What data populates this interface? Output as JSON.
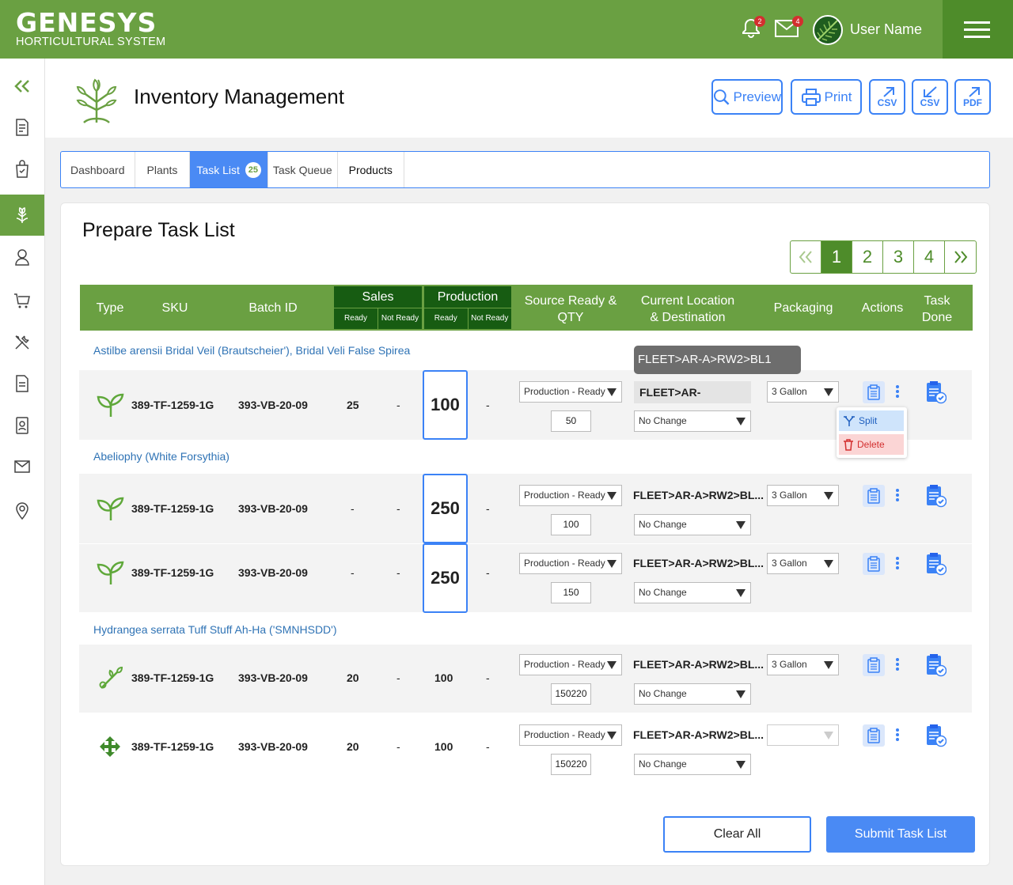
{
  "app": {
    "brand": "GENESYS",
    "brand_sub": "HORTICULTURAL SYSTEM",
    "notif_count": "2",
    "mail_count": "4",
    "user_name": "User Name"
  },
  "page": {
    "title": "Inventory Management",
    "toolbar": {
      "preview": "Preview",
      "print": "Print",
      "csv_export": "CSV",
      "csv_import": "CSV",
      "pdf": "PDF"
    }
  },
  "tabs": [
    {
      "label": "Dashboard"
    },
    {
      "label": "Plants"
    },
    {
      "label": "Task List",
      "badge": "25"
    },
    {
      "label": "Task Queue"
    },
    {
      "label": "Products"
    }
  ],
  "section_title": "Prepare Task List",
  "pagination": {
    "pages": [
      "1",
      "2",
      "3",
      "4"
    ],
    "current": "1"
  },
  "table": {
    "headers": {
      "type": "Type",
      "sku": "SKU",
      "batch": "Batch ID",
      "sales": "Sales",
      "production": "Production",
      "ready": "Ready",
      "not_ready": "Not Ready",
      "source_l1": "Source Ready &",
      "source_l2": "QTY",
      "loc_l1": "Current Location",
      "loc_l2": "& Destination",
      "packaging": "Packaging",
      "actions": "Actions",
      "done_l1": "Task",
      "done_l2": "Done"
    },
    "groups": [
      "Astilbe arensii Bridal Veil (Brautscheier'), Bridal Veli False Spirea",
      "Abeliophy (White Forsythia)",
      "Hydrangea serrata Tuff Stuff Ah-Ha ('SMNHSDD')"
    ],
    "rows": [
      {
        "type_icon": "sprout-icon",
        "sku": "389-TF-1259-1G",
        "batch": "393-VB-20-09",
        "sales_ready": "25",
        "sales_not_ready": "-",
        "prod_ready": "100",
        "prod_not_ready": "-",
        "source": "Production - Ready",
        "qty": "50",
        "location": "FLEET>AR-A>RW2>...",
        "destination": "No Change",
        "packaging": "3 Gallon"
      },
      {
        "type_icon": "sprout-icon",
        "sku": "389-TF-1259-1G",
        "batch": "393-VB-20-09",
        "sales_ready": "-",
        "sales_not_ready": "-",
        "prod_ready": "250",
        "prod_not_ready": "-",
        "source": "Production - Ready",
        "qty": "100",
        "location": "FLEET>AR-A>RW2>BL...",
        "destination": "No Change",
        "packaging": "3 Gallon"
      },
      {
        "type_icon": "sprout-icon",
        "sku": "389-TF-1259-1G",
        "batch": "393-VB-20-09",
        "sales_ready": "-",
        "sales_not_ready": "-",
        "prod_ready": "250",
        "prod_not_ready": "-",
        "source": "Production - Ready",
        "qty": "150",
        "location": "FLEET>AR-A>RW2>BL...",
        "destination": "No Change",
        "packaging": "3 Gallon"
      },
      {
        "type_icon": "cutting-icon",
        "sku": "389-TF-1259-1G",
        "batch": "393-VB-20-09",
        "sales_ready": "20",
        "sales_not_ready": "-",
        "prod_ready": "100",
        "prod_not_ready": "-",
        "source": "Production - Ready",
        "qty": "150220",
        "location": "FLEET>AR-A>RW2>BL...",
        "destination": "No Change",
        "packaging": "3 Gallon"
      },
      {
        "type_icon": "move-icon",
        "sku": "389-TF-1259-1G",
        "batch": "393-VB-20-09",
        "sales_ready": "20",
        "sales_not_ready": "-",
        "prod_ready": "100",
        "prod_not_ready": "-",
        "source": "Production - Ready",
        "qty": "150220",
        "location": "FLEET>AR-A>RW2>BL...",
        "destination": "No Change",
        "packaging": ""
      }
    ]
  },
  "tooltip": "FLEET>AR-A>RW2>BL1",
  "row_menu": {
    "split": "Split",
    "delete": "Delete"
  },
  "buttons": {
    "clear": "Clear All",
    "submit": "Submit Task List"
  },
  "colors": {
    "brand_green": "#6aa042",
    "dark_green": "#175c12",
    "accent_blue": "#3b82f6"
  }
}
